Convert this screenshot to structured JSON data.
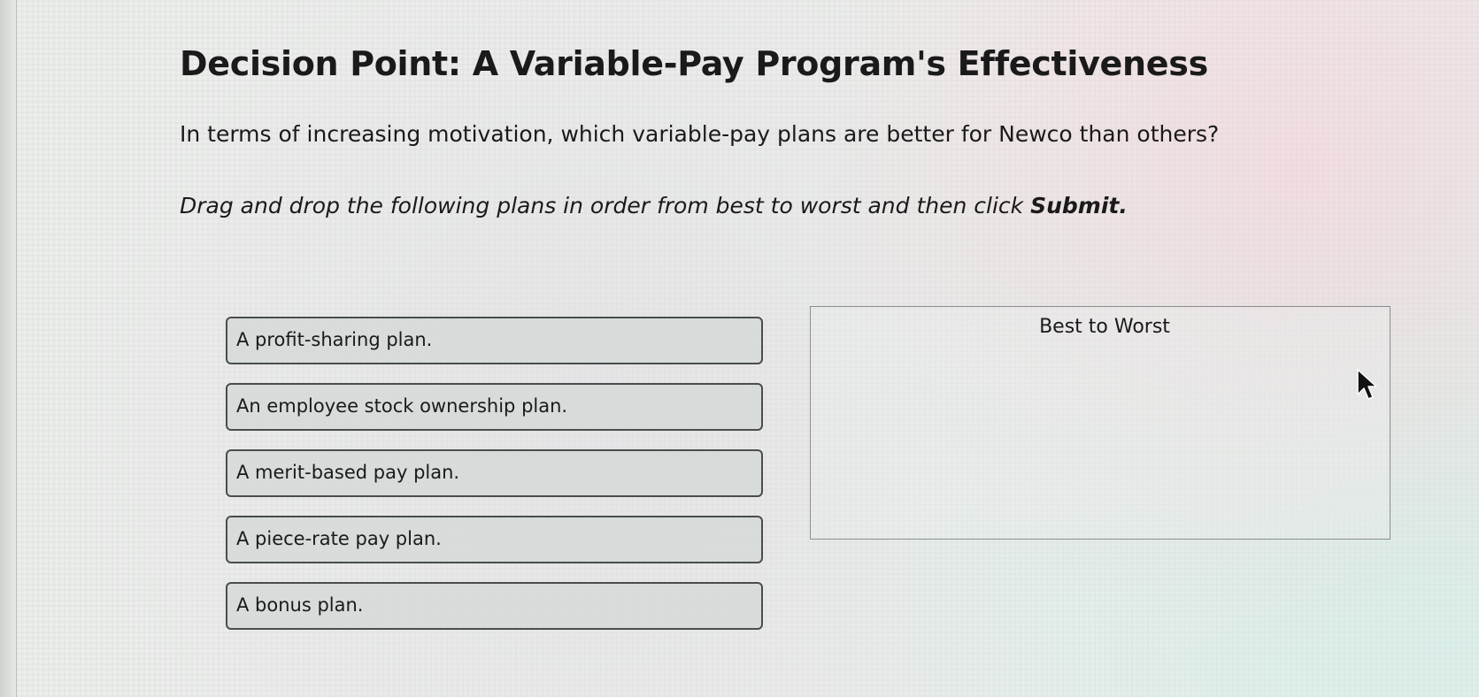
{
  "page": {
    "title": "Decision Point: A Variable-Pay Program's Effectiveness",
    "question": "In terms of increasing motivation, which variable-pay plans are better for Newco than others?",
    "instruction_prefix": "Drag and drop the following plans in order from best to worst and then click ",
    "instruction_emphasis": "Submit."
  },
  "plans": [
    "A profit-sharing plan.",
    "An employee stock ownership plan.",
    "A merit-based pay plan.",
    "A piece-rate pay plan.",
    "A bonus plan."
  ],
  "drop_zone": {
    "label": "Best to Worst"
  },
  "icons": {
    "cursor": "mouse-pointer-icon"
  }
}
